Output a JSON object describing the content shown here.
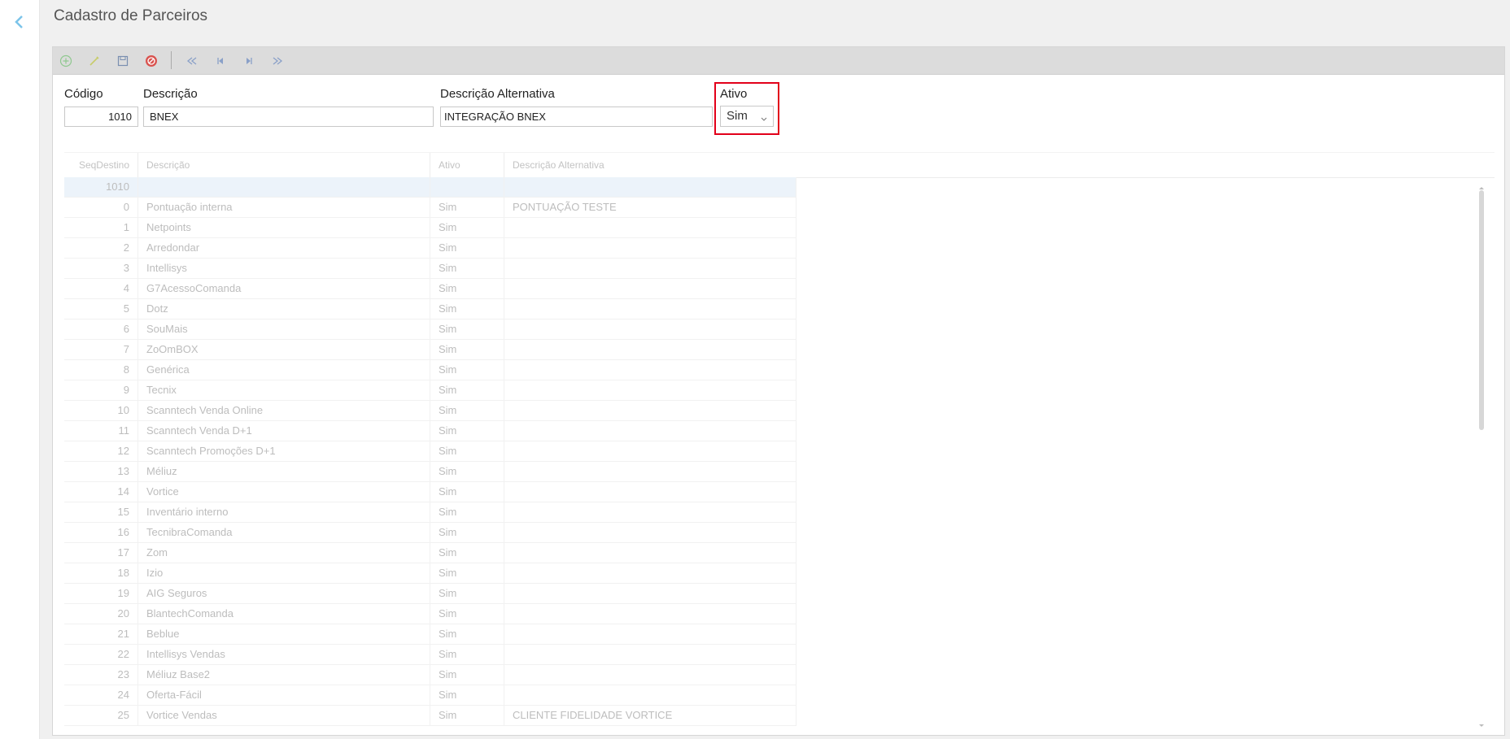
{
  "page": {
    "title": "Cadastro de Parceiros"
  },
  "form": {
    "codigo_label": "Código",
    "codigo_value": "1010",
    "descricao_label": "Descrição",
    "descricao_value": "BNEX",
    "descricao_alt_label": "Descrição Alternativa",
    "descricao_alt_value": "INTEGRAÇÃO BNEX",
    "ativo_label": "Ativo",
    "ativo_value": "Sim"
  },
  "toolbar": {
    "icons": [
      "add-icon",
      "edit-icon",
      "save-icon",
      "cancel-icon",
      "first-record-icon",
      "previous-record-icon",
      "next-record-icon",
      "last-record-icon"
    ]
  },
  "grid": {
    "columns": [
      "SeqDestino",
      "Descrição",
      "Ativo",
      "Descrição Alternativa"
    ],
    "rows": [
      {
        "seq": "1010",
        "desc": "",
        "ativo": "",
        "alt": ""
      },
      {
        "seq": "0",
        "desc": "Pontuação interna",
        "ativo": "Sim",
        "alt": "PONTUAÇÃO TESTE"
      },
      {
        "seq": "1",
        "desc": "Netpoints",
        "ativo": "Sim",
        "alt": ""
      },
      {
        "seq": "2",
        "desc": "Arredondar",
        "ativo": "Sim",
        "alt": ""
      },
      {
        "seq": "3",
        "desc": "Intellisys",
        "ativo": "Sim",
        "alt": ""
      },
      {
        "seq": "4",
        "desc": "G7AcessoComanda",
        "ativo": "Sim",
        "alt": ""
      },
      {
        "seq": "5",
        "desc": "Dotz",
        "ativo": "Sim",
        "alt": ""
      },
      {
        "seq": "6",
        "desc": "SouMais",
        "ativo": "Sim",
        "alt": ""
      },
      {
        "seq": "7",
        "desc": "ZoOmBOX",
        "ativo": "Sim",
        "alt": ""
      },
      {
        "seq": "8",
        "desc": "Genérica",
        "ativo": "Sim",
        "alt": ""
      },
      {
        "seq": "9",
        "desc": "Tecnix",
        "ativo": "Sim",
        "alt": ""
      },
      {
        "seq": "10",
        "desc": "Scanntech Venda Online",
        "ativo": "Sim",
        "alt": ""
      },
      {
        "seq": "11",
        "desc": "Scanntech Venda D+1",
        "ativo": "Sim",
        "alt": ""
      },
      {
        "seq": "12",
        "desc": "Scanntech Promoções D+1",
        "ativo": "Sim",
        "alt": ""
      },
      {
        "seq": "13",
        "desc": "Méliuz",
        "ativo": "Sim",
        "alt": ""
      },
      {
        "seq": "14",
        "desc": "Vortice",
        "ativo": "Sim",
        "alt": ""
      },
      {
        "seq": "15",
        "desc": "Inventário interno",
        "ativo": "Sim",
        "alt": ""
      },
      {
        "seq": "16",
        "desc": "TecnibraComanda",
        "ativo": "Sim",
        "alt": ""
      },
      {
        "seq": "17",
        "desc": "Zom",
        "ativo": "Sim",
        "alt": ""
      },
      {
        "seq": "18",
        "desc": "Izio",
        "ativo": "Sim",
        "alt": ""
      },
      {
        "seq": "19",
        "desc": "AIG Seguros",
        "ativo": "Sim",
        "alt": ""
      },
      {
        "seq": "20",
        "desc": "BlantechComanda",
        "ativo": "Sim",
        "alt": ""
      },
      {
        "seq": "21",
        "desc": "Beblue",
        "ativo": "Sim",
        "alt": ""
      },
      {
        "seq": "22",
        "desc": "Intellisys Vendas",
        "ativo": "Sim",
        "alt": ""
      },
      {
        "seq": "23",
        "desc": "Méliuz Base2",
        "ativo": "Sim",
        "alt": ""
      },
      {
        "seq": "24",
        "desc": "Oferta-Fácil",
        "ativo": "Sim",
        "alt": ""
      },
      {
        "seq": "25",
        "desc": "Vortice Vendas",
        "ativo": "Sim",
        "alt": "CLIENTE FIDELIDADE VORTICE"
      }
    ]
  },
  "colors": {
    "highlight": "#e2001a",
    "accent": "#39a9e0"
  }
}
